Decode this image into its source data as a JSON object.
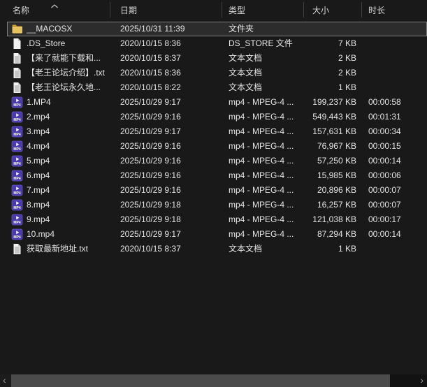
{
  "columns": [
    {
      "id": "name",
      "label": "名称",
      "sorted": "ascending"
    },
    {
      "id": "date",
      "label": "日期"
    },
    {
      "id": "type",
      "label": "类型"
    },
    {
      "id": "size",
      "label": "大小"
    },
    {
      "id": "duration",
      "label": "时长"
    }
  ],
  "rows": [
    {
      "icon": "folder-icon",
      "name": "__MACOSX",
      "date": "2025/10/31 11:39",
      "type": "文件夹",
      "size": "",
      "duration": "",
      "selected": true
    },
    {
      "icon": "blank-file-icon",
      "name": ".DS_Store",
      "date": "2020/10/15 8:36",
      "type": "DS_STORE 文件",
      "size": "7 KB",
      "duration": "",
      "selected": false
    },
    {
      "icon": "text-file-icon",
      "name": "【来了就能下载和...",
      "date": "2020/10/15 8:37",
      "type": "文本文档",
      "size": "2 KB",
      "duration": "",
      "selected": false
    },
    {
      "icon": "text-file-icon",
      "name": "【老王论坛介绍】.txt",
      "date": "2020/10/15 8:36",
      "type": "文本文档",
      "size": "2 KB",
      "duration": "",
      "selected": false
    },
    {
      "icon": "text-file-icon",
      "name": "【老王论坛永久地...",
      "date": "2020/10/15 8:22",
      "type": "文本文档",
      "size": "1 KB",
      "duration": "",
      "selected": false
    },
    {
      "icon": "mp4-icon",
      "name": "1.MP4",
      "date": "2025/10/29 9:17",
      "type": "mp4 - MPEG-4 ...",
      "size": "199,237 KB",
      "duration": "00:00:58",
      "selected": false
    },
    {
      "icon": "mp4-icon",
      "name": "2.mp4",
      "date": "2025/10/29 9:16",
      "type": "mp4 - MPEG-4 ...",
      "size": "549,443 KB",
      "duration": "00:01:31",
      "selected": false
    },
    {
      "icon": "mp4-icon",
      "name": "3.mp4",
      "date": "2025/10/29 9:17",
      "type": "mp4 - MPEG-4 ...",
      "size": "157,631 KB",
      "duration": "00:00:34",
      "selected": false
    },
    {
      "icon": "mp4-icon",
      "name": "4.mp4",
      "date": "2025/10/29 9:16",
      "type": "mp4 - MPEG-4 ...",
      "size": "76,967 KB",
      "duration": "00:00:15",
      "selected": false
    },
    {
      "icon": "mp4-icon",
      "name": "5.mp4",
      "date": "2025/10/29 9:16",
      "type": "mp4 - MPEG-4 ...",
      "size": "57,250 KB",
      "duration": "00:00:14",
      "selected": false
    },
    {
      "icon": "mp4-icon",
      "name": "6.mp4",
      "date": "2025/10/29 9:16",
      "type": "mp4 - MPEG-4 ...",
      "size": "15,985 KB",
      "duration": "00:00:06",
      "selected": false
    },
    {
      "icon": "mp4-icon",
      "name": "7.mp4",
      "date": "2025/10/29 9:16",
      "type": "mp4 - MPEG-4 ...",
      "size": "20,896 KB",
      "duration": "00:00:07",
      "selected": false
    },
    {
      "icon": "mp4-icon",
      "name": "8.mp4",
      "date": "2025/10/29 9:18",
      "type": "mp4 - MPEG-4 ...",
      "size": "16,257 KB",
      "duration": "00:00:07",
      "selected": false
    },
    {
      "icon": "mp4-icon",
      "name": "9.mp4",
      "date": "2025/10/29 9:18",
      "type": "mp4 - MPEG-4 ...",
      "size": "121,038 KB",
      "duration": "00:00:17",
      "selected": false
    },
    {
      "icon": "mp4-icon",
      "name": "10.mp4",
      "date": "2025/10/29 9:17",
      "type": "mp4 - MPEG-4 ...",
      "size": "87,294 KB",
      "duration": "00:00:14",
      "selected": false
    },
    {
      "icon": "text-file-icon",
      "name": "获取最新地址.txt",
      "date": "2020/10/15 8:37",
      "type": "文本文档",
      "size": "1 KB",
      "duration": "",
      "selected": false
    }
  ],
  "scrollbar": {
    "left_arrow": "‹",
    "right_arrow": "›"
  },
  "colors": {
    "background": "#191919",
    "selected_row_bg": "#2c2c2c",
    "selected_row_border": "#7f7f7f",
    "header_divider": "#3f3f3f",
    "text": "#e6e6e6",
    "folder_yellow": "#e6c25d",
    "mp4_purple": "#4a3ab0",
    "scroll_thumb": "#4b4b4b"
  }
}
